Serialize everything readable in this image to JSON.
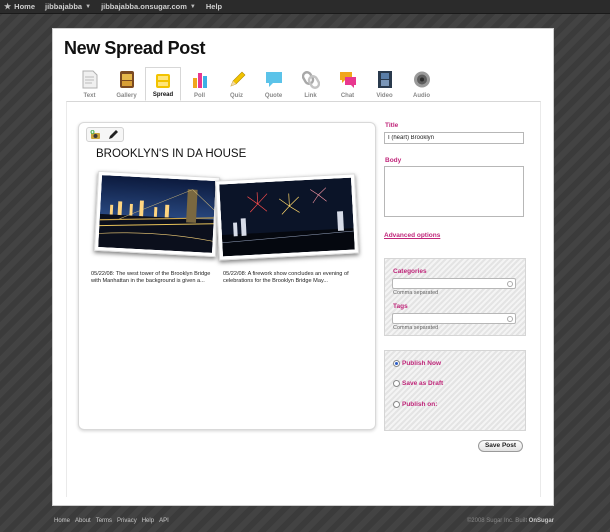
{
  "topbar": {
    "home": "Home",
    "user": "jibbajabba",
    "site": "jibbajabba.onsugar.com",
    "help": "Help"
  },
  "page": {
    "title": "New Spread Post"
  },
  "tabs": [
    {
      "label": "Text",
      "icon": "text-icon"
    },
    {
      "label": "Gallery",
      "icon": "gallery-icon"
    },
    {
      "label": "Spread",
      "icon": "spread-icon",
      "active": true
    },
    {
      "label": "Poll",
      "icon": "poll-icon"
    },
    {
      "label": "Quiz",
      "icon": "quiz-icon"
    },
    {
      "label": "Quote",
      "icon": "quote-icon"
    },
    {
      "label": "Link",
      "icon": "link-icon"
    },
    {
      "label": "Chat",
      "icon": "chat-icon"
    },
    {
      "label": "Video",
      "icon": "video-icon"
    },
    {
      "label": "Audio",
      "icon": "audio-icon"
    }
  ],
  "spread": {
    "heading": "BROOKLYN'S IN DA HOUSE",
    "captions": [
      "05/22/08: The west tower of the Brooklyn Bridge with Manhattan in the background is given a...",
      "05/22/08: A firework show concludes an evening of celebrations for the Brooklyn Bridge May..."
    ]
  },
  "form": {
    "title_label": "Title",
    "title_value": "I (heart) Brooklyn",
    "body_label": "Body",
    "advanced_link": "Advanced options",
    "categories_label": "Categories",
    "categories_hint": "Comma separated",
    "tags_label": "Tags",
    "tags_hint": "Comma separated",
    "publish_options": [
      "Publish Now",
      "Save as Draft",
      "Publish on:"
    ],
    "selected_publish": "Publish Now",
    "save_button": "Save Post"
  },
  "footer": {
    "links": [
      "Home",
      "About",
      "Terms",
      "Privacy",
      "Help",
      "API"
    ],
    "copyright": "©2008 Sugar Inc. Built",
    "brand": "OnSugar"
  },
  "colors": {
    "accent": "#c0267a",
    "background": "#3d3d3d",
    "radio_selected": "#2e5ec8"
  }
}
